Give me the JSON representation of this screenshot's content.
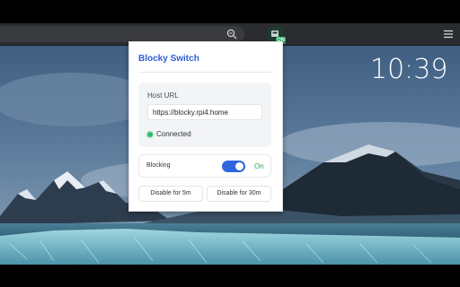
{
  "browser": {
    "extension_badge": "ON",
    "icons": [
      "zoom-icon",
      "extension-icon",
      "menu-icon"
    ]
  },
  "desktop": {
    "clock": "10:39"
  },
  "popup": {
    "title": "Blocky Switch",
    "host_label": "Host URL",
    "host_value": "https://blocky.rpi4.home",
    "status": "Connected",
    "blocking_label": "Blocking",
    "blocking_state": "On",
    "blocking_enabled": true,
    "disable_5m": "Disable for 5m",
    "disable_30m": "Disable for 30m"
  },
  "colors": {
    "accent": "#2f66e0",
    "title": "#2d5fd3",
    "status_green": "#2ebd6a"
  }
}
